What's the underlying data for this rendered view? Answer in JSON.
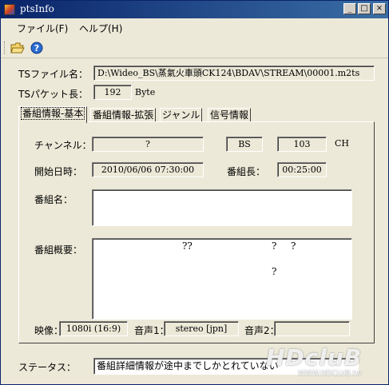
{
  "window": {
    "title": "ptsInfo"
  },
  "titlebar_buttons": {
    "minimize": "_",
    "maximize": "□",
    "close": "×"
  },
  "menu": {
    "file": "ファイル(F)",
    "help": "ヘルプ(H)"
  },
  "toolbar": {
    "icons": [
      "open-folder-icon",
      "help-icon"
    ]
  },
  "ts_file": {
    "label": "TSファイル名：",
    "value": "D:\\Wideo_BS\\蒸氣火車頭CK124\\BDAV\\STREAM\\00001.m2ts"
  },
  "ts_packet": {
    "label": "TSパケット長：",
    "value": "192",
    "unit": "Byte"
  },
  "tabs": [
    {
      "label": "番組情報-基本"
    },
    {
      "label": "番組情報-拡張"
    },
    {
      "label": "ジャンル"
    },
    {
      "label": "信号情報"
    }
  ],
  "basic": {
    "channel_label": "チャンネル：",
    "channel_value": "?",
    "network_value": "BS",
    "channel_number": "103",
    "channel_unit": "CH",
    "start_label": "開始日時：",
    "start_value": "2010/06/06 07:30:00",
    "duration_label": "番組長：",
    "duration_value": "00:25:00",
    "name_label": "番組名：",
    "name_value": "",
    "summary_label": "番組概要：",
    "summary_q1": "??",
    "summary_q2": "?",
    "summary_q3": "?",
    "summary_q4": "?",
    "video_label": "映像：",
    "video_value": "1080i (16:9)",
    "audio1_label": "音声1：",
    "audio1_value": "stereo [jpn]",
    "audio2_label": "音声2：",
    "audio2_value": ""
  },
  "status": {
    "label": "ステータス：",
    "value": "番組詳細情報が途中までしかとれていない"
  },
  "watermark": {
    "logo": "HDcluB",
    "text": "WWW.HDCLUB.tw"
  }
}
